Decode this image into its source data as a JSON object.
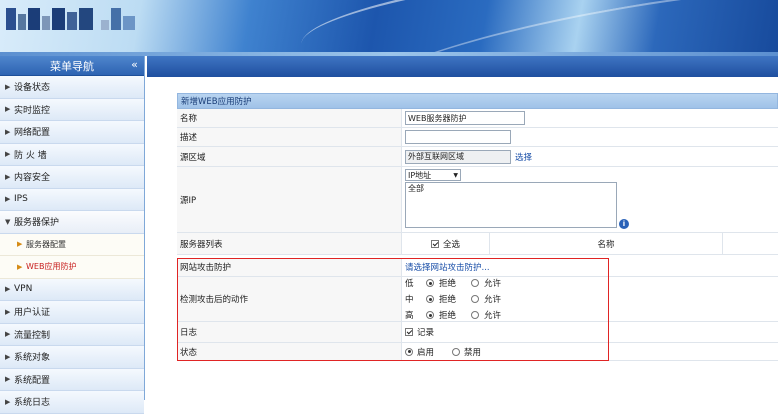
{
  "sidebar": {
    "title": "菜单导航",
    "items": [
      {
        "label": "设备状态"
      },
      {
        "label": "实时监控"
      },
      {
        "label": "网络配置"
      },
      {
        "label": "防 火 墙"
      },
      {
        "label": "内容安全"
      },
      {
        "label": "IPS"
      },
      {
        "label": "服务器保护"
      },
      {
        "label": "服务器配置"
      },
      {
        "label": "WEB应用防护"
      },
      {
        "label": "VPN"
      },
      {
        "label": "用户认证"
      },
      {
        "label": "流量控制"
      },
      {
        "label": "系统对象"
      },
      {
        "label": "系统配置"
      },
      {
        "label": "系统日志"
      }
    ]
  },
  "form": {
    "title": "新增WEB应用防护",
    "name_label": "名称",
    "name_value": "WEB服务器防护",
    "desc_label": "描述",
    "desc_value": "",
    "srczone_label": "源区域",
    "srczone_value": "外部互联网区域",
    "srczone_select": "选择",
    "srcip_label": "源IP",
    "srcip_type": "IP地址",
    "srcip_value": "全部",
    "info_icon": "info-icon",
    "server_list_label": "服务器列表",
    "select_all": "全选",
    "col_name": "名称",
    "attack_label": "网站攻击防护",
    "attack_link": "请选择网站攻击防护...",
    "action_label": "检测攻击后的动作",
    "levels": [
      {
        "level": "低",
        "deny": "拒绝",
        "allow": "允许",
        "selected": "deny"
      },
      {
        "level": "中",
        "deny": "拒绝",
        "allow": "允许",
        "selected": "deny"
      },
      {
        "level": "高",
        "deny": "拒绝",
        "allow": "允许",
        "selected": "deny"
      }
    ],
    "log_label": "日志",
    "log_record": "记录",
    "status_label": "状态",
    "enable": "启用",
    "disable": "禁用"
  }
}
